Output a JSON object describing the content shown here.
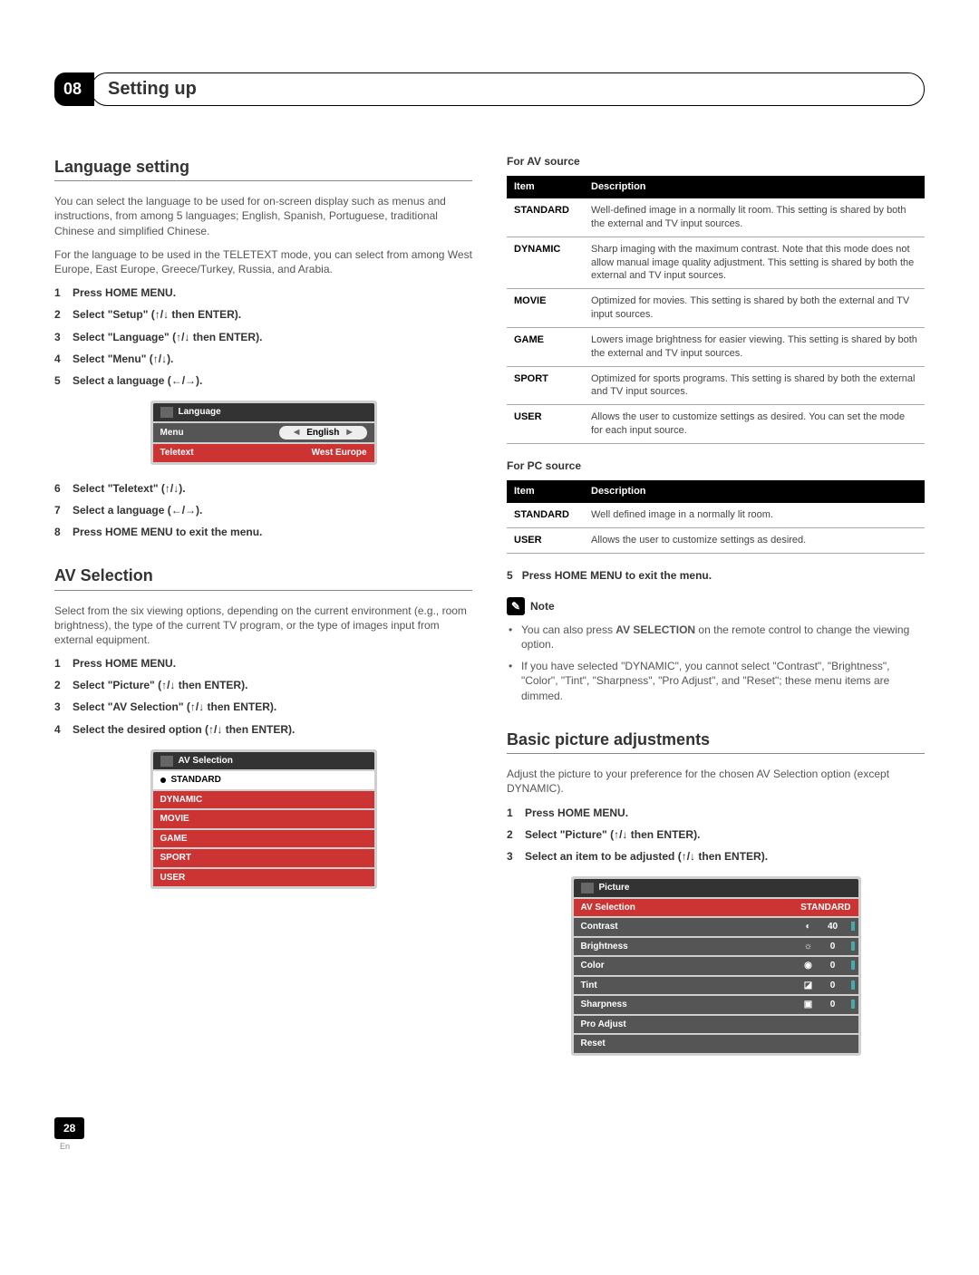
{
  "chapter": {
    "num": "08",
    "title": "Setting up"
  },
  "left": {
    "lang_section": {
      "heading": "Language setting",
      "intro1": "You can select the language to be used for on-screen display such as menus and instructions, from among 5 languages; English, Spanish, Portuguese, traditional Chinese and simplified Chinese.",
      "intro2": "For the language to be used in the TELETEXT mode, you can select from among West Europe, East Europe, Greece/Turkey, Russia, and Arabia.",
      "steps_a": [
        "Press HOME MENU.",
        "Select \"Setup\" (↑/↓ then ENTER).",
        "Select \"Language\" (↑/↓ then ENTER).",
        "Select \"Menu\" (↑/↓).",
        "Select a language (←/→)."
      ],
      "osd_title": "Language",
      "osd_rows": [
        {
          "label": "Menu",
          "value": "English"
        },
        {
          "label": "Teletext",
          "value": "West Europe"
        }
      ],
      "steps_b": [
        "Select \"Teletext\" (↑/↓).",
        "Select a language (←/→).",
        "Press HOME MENU to exit the menu."
      ]
    },
    "av_section": {
      "heading": "AV Selection",
      "intro": "Select from the six viewing options, depending on the current environment (e.g., room brightness), the type of the current TV program, or the type of images input from external equipment.",
      "steps": [
        "Press HOME MENU.",
        "Select \"Picture\" (↑/↓ then ENTER).",
        "Select \"AV Selection\" (↑/↓ then ENTER).",
        "Select the desired option (↑/↓ then ENTER)."
      ],
      "osd_title": "AV Selection",
      "osd_items": [
        "STANDARD",
        "DYNAMIC",
        "MOVIE",
        "GAME",
        "SPORT",
        "USER"
      ]
    }
  },
  "right": {
    "av_table_head": "For AV source",
    "col_item": "Item",
    "col_desc": "Description",
    "av_rows": [
      {
        "item": "STANDARD",
        "desc": "Well-defined image in a normally lit room.\nThis setting is shared by both the external and TV input sources."
      },
      {
        "item": "DYNAMIC",
        "desc": "Sharp imaging with the maximum contrast.\nNote that this mode does not allow manual image quality adjustment.\nThis setting is shared by both the external and TV input sources."
      },
      {
        "item": "MOVIE",
        "desc": "Optimized for movies.\nThis setting is shared by both the external and TV input sources."
      },
      {
        "item": "GAME",
        "desc": "Lowers image brightness for easier viewing.\nThis setting is shared by both the external and TV input sources."
      },
      {
        "item": "SPORT",
        "desc": "Optimized for sports programs.\nThis setting is shared by both the external and TV input sources."
      },
      {
        "item": "USER",
        "desc": "Allows the user to customize settings as desired. You can set the mode for each input source."
      }
    ],
    "pc_table_head": "For PC source",
    "pc_rows": [
      {
        "item": "STANDARD",
        "desc": "Well defined image in a normally lit room."
      },
      {
        "item": "USER",
        "desc": "Allows the user to customize settings as desired."
      }
    ],
    "step5": "Press HOME MENU to exit the menu.",
    "step5_num": "5",
    "note_label": "Note",
    "note_items": [
      {
        "pre": "You can also press ",
        "bold": "AV SELECTION",
        "post": " on the remote control to change the viewing option."
      },
      {
        "pre": "If you have selected \"DYNAMIC\", you cannot select \"Contrast\", \"Brightness\", \"Color\", \"Tint\", \"Sharpness\", \"Pro Adjust\", and \"Reset\"; these menu items are dimmed.",
        "bold": "",
        "post": ""
      }
    ],
    "basic_section": {
      "heading": "Basic picture adjustments",
      "intro": "Adjust the picture to your preference for the chosen AV Selection option (except DYNAMIC).",
      "steps": [
        "Press HOME MENU.",
        "Select \"Picture\" (↑/↓ then ENTER).",
        "Select an item to be adjusted (↑/↓ then ENTER)."
      ],
      "osd_title": "Picture",
      "osd_rows": [
        {
          "label": "AV Selection",
          "value": "STANDARD",
          "type": "sel"
        },
        {
          "label": "Contrast",
          "value": "40",
          "type": "slider"
        },
        {
          "label": "Brightness",
          "value": "0",
          "type": "slider"
        },
        {
          "label": "Color",
          "value": "0",
          "type": "slider"
        },
        {
          "label": "Tint",
          "value": "0",
          "type": "slider"
        },
        {
          "label": "Sharpness",
          "value": "0",
          "type": "slider"
        },
        {
          "label": "Pro Adjust",
          "value": "",
          "type": "plain"
        },
        {
          "label": "Reset",
          "value": "",
          "type": "plain"
        }
      ]
    }
  },
  "footer": {
    "page": "28",
    "lang": "En"
  }
}
